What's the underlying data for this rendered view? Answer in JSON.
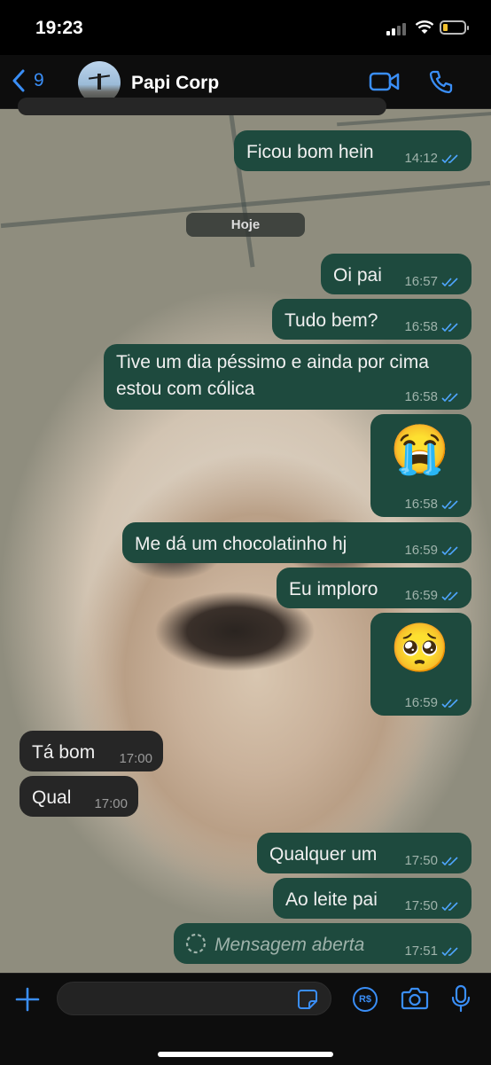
{
  "status_bar": {
    "time": "19:23"
  },
  "header": {
    "back_count": "9",
    "contact_name": "Papi Corp"
  },
  "day_separator": "Hoje",
  "messages": [
    {
      "text": "Ficou bom hein",
      "time": "14:12",
      "dir": "out"
    },
    {
      "text": "Oi pai",
      "time": "16:57",
      "dir": "out"
    },
    {
      "text": "Tudo bem?",
      "time": "16:58",
      "dir": "out"
    },
    {
      "line1": "Tive um dia péssimo e ainda por cima",
      "line2": "estou com cólica",
      "time": "16:58",
      "dir": "out"
    },
    {
      "text": "😭",
      "time": "16:58",
      "dir": "out"
    },
    {
      "text": "Me dá um chocolatinho hj",
      "time": "16:59",
      "dir": "out"
    },
    {
      "text": "Eu imploro",
      "time": "16:59",
      "dir": "out"
    },
    {
      "text": "🥺",
      "time": "16:59",
      "dir": "out"
    },
    {
      "text": "Tá bom",
      "time": "17:00",
      "dir": "in"
    },
    {
      "text": "Qual",
      "time": "17:00",
      "dir": "in"
    },
    {
      "text": "Qualquer um",
      "time": "17:50",
      "dir": "out"
    },
    {
      "text": "Ao leite pai",
      "time": "17:50",
      "dir": "out"
    },
    {
      "text": "Mensagem aberta",
      "time": "17:51",
      "dir": "out"
    }
  ],
  "composer": {
    "payment_icon_text": "R$"
  },
  "colors": {
    "accent": "#3a8ef6",
    "outgoing_bubble": "#1e4a3e",
    "incoming_bubble": "#262626",
    "read_ticks": "#4fa6ff"
  }
}
